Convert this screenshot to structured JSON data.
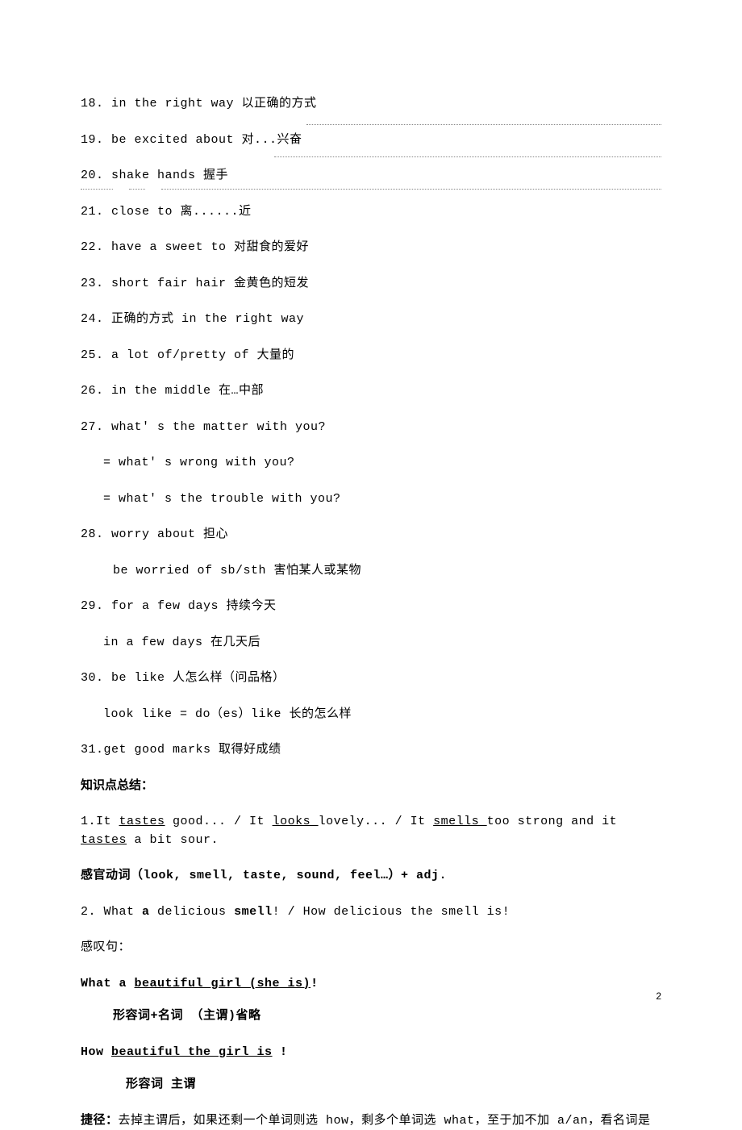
{
  "items": {
    "18": "18. in the right way   以正确的方式",
    "19": "19. be excited about   对...兴奋",
    "20": "20. shake hands   握手",
    "21": "21. close to   离......近",
    "22": "22. have a sweet to 对甜食的爱好",
    "23": "23. short fair hair   金黄色的短发",
    "24": "24. 正确的方式 in the right way",
    "25": "25. a lot of/pretty of 大量的",
    "26": "26. in the middle  在…中部",
    "27": "27. what' s the matter with you?",
    "27a": "= what' s wrong with you?",
    "27b": "= what' s the trouble with you?",
    "28": "28. worry about   担心",
    "28a": "be worried of sb/sth   害怕某人或某物",
    "29": "29. for a few days 持续今天",
    "29a": "in a few days    在几天后",
    "30": "30. be like 人怎么样（问品格）",
    "30a": "look like = do（es）like 长的怎么样",
    "31": "31.get good marks   取得好成绩"
  },
  "section_heading": "知识点总结：",
  "point1": {
    "pre": "1.It ",
    "u1": "tastes",
    "mid1": " good... / It ",
    "u2": "looks ",
    "mid2": "lovely... / It ",
    "u3": "smells ",
    "mid3": "too strong and it ",
    "u4": "tastes",
    "post": " a bit sour."
  },
  "sense_verbs": "感官动词（look, smell, taste, sound, feel…）+ adj.",
  "point2": {
    "pre": "2. What ",
    "b1": "a",
    "mid1": " delicious ",
    "b2": "smell",
    "mid2": "!      /   How delicious the smell is!"
  },
  "excl_label": " 感叹句：",
  "what_sent": {
    "pre": "What a ",
    "u": "beautiful girl (she is)",
    "post": "!"
  },
  "what_note": "形容词+名词   （主谓)省略",
  "how_sent": {
    "pre": "How ",
    "u": "beautiful the girl is",
    "post": " !"
  },
  "how_note": "形容词    主谓",
  "shortcut": {
    "label": "捷径：",
    "text": "去掉主谓后，如果还剩一个单词则选 how，剩多个单词选 what，至于加不加 a/an，看名词是"
  },
  "page_number": "2"
}
